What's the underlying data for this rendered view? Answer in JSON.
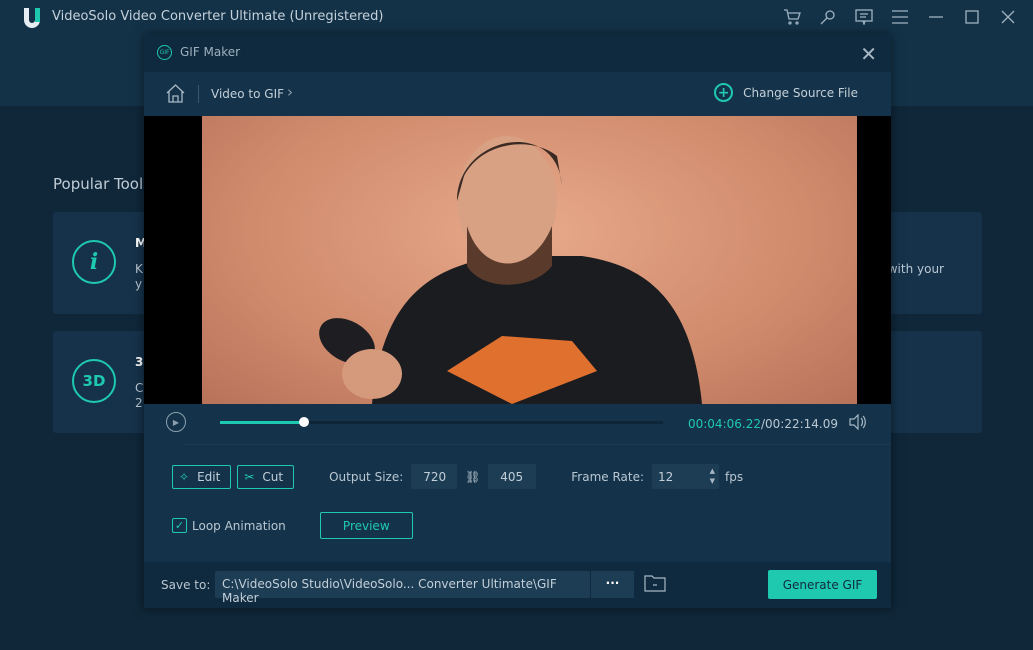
{
  "app": {
    "title": "VideoSolo Video Converter Ultimate (Unregistered)",
    "accent": "#1fc9b0"
  },
  "toolbar_icons": [
    "cart-icon",
    "key-icon",
    "feedback-icon",
    "menu-icon",
    "minimize-icon",
    "maximize-icon",
    "close-icon"
  ],
  "background": {
    "popular_tools": "Popular Tools",
    "cards": [
      {
        "icon": "i",
        "title": "M",
        "desc1": "K",
        "desc2": "y",
        "right": "with your"
      },
      {
        "icon": "3D",
        "title": "3",
        "desc1": "C",
        "desc2": "2"
      }
    ]
  },
  "dialog": {
    "title": "GIF Maker",
    "icon_text": "GIF",
    "breadcrumb": {
      "item": "Video to GIF"
    },
    "change_source": "Change Source File",
    "player": {
      "current": "00:04:06.22",
      "total": "/00:22:14.09",
      "progress_fraction": 0.19
    },
    "edit": "Edit",
    "cut": "Cut",
    "output_size_label": "Output Size:",
    "width": "720",
    "height": "405",
    "frame_rate_label": "Frame Rate:",
    "frame_rate": "12",
    "fps": "fps",
    "loop_label": "Loop Animation",
    "loop_checked": true,
    "preview": "Preview",
    "save_label": "Save to:",
    "save_path": "C:\\VideoSolo Studio\\VideoSolo... Converter Ultimate\\GIF Maker",
    "dots": "···",
    "generate": "Generate GIF"
  }
}
